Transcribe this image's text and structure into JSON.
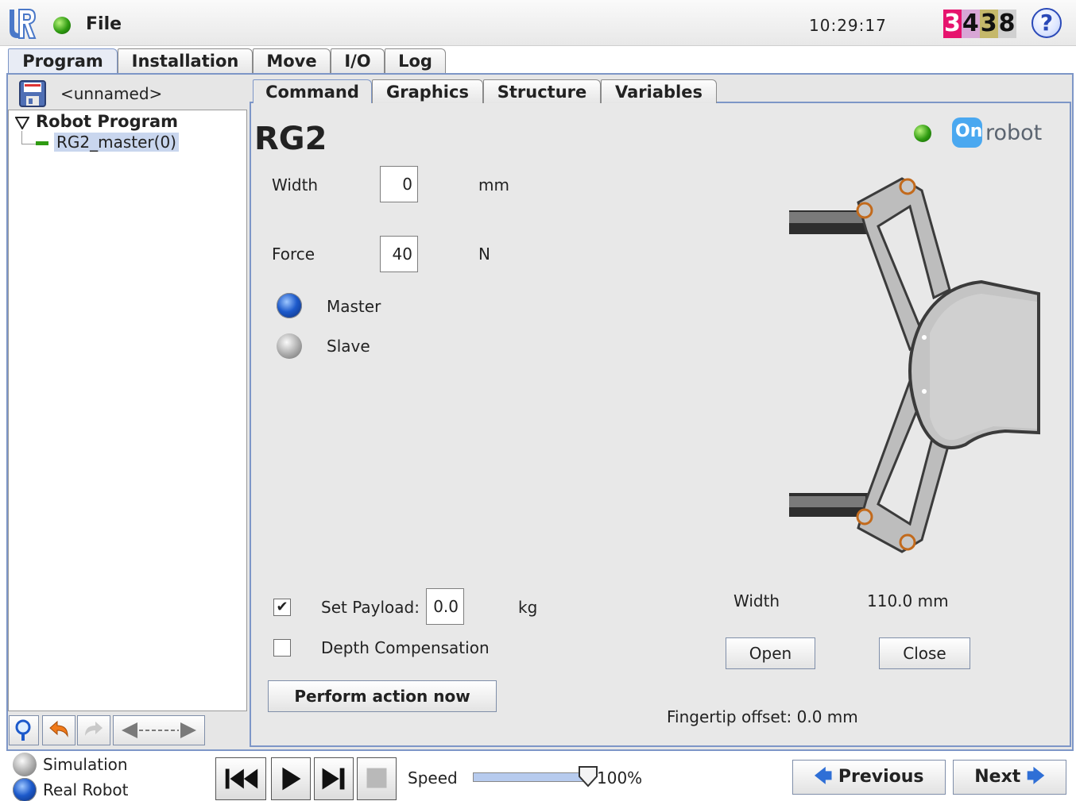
{
  "topbar": {
    "file_label": "File",
    "clock": "10:29:17",
    "counter_digits": [
      "3",
      "4",
      "3",
      "8"
    ],
    "counter_colors": [
      "#e6146e",
      "#d8a6d6",
      "#c5b86a",
      "#d0d0d0"
    ],
    "help_label": "?"
  },
  "main_tabs": [
    "Program",
    "Installation",
    "Move",
    "I/O",
    "Log"
  ],
  "program": {
    "filename": "<unnamed>",
    "tree_root": "Robot Program",
    "tree_child": "RG2_master(0)"
  },
  "sub_tabs": [
    "Command",
    "Graphics",
    "Structure",
    "Variables"
  ],
  "rg2": {
    "title": "RG2",
    "width_label": "Width",
    "width_value": "0",
    "width_unit": "mm",
    "force_label": "Force",
    "force_value": "40",
    "force_unit": "N",
    "master_label": "Master",
    "slave_label": "Slave",
    "brand": "robot",
    "brand_badge": "On",
    "payload_label": "Set Payload:",
    "payload_value": "0.0",
    "payload_unit": "kg",
    "payload_checked": true,
    "depth_label": "Depth Compensation",
    "depth_checked": false,
    "perform_label": "Perform action now",
    "gripper_width_label": "Width",
    "gripper_width_value": "110.0 mm",
    "open_label": "Open",
    "close_label": "Close",
    "fingertip_label": "Fingertip offset: 0.0 mm"
  },
  "bottom": {
    "simulation_label": "Simulation",
    "real_robot_label": "Real Robot",
    "speed_label": "Speed",
    "speed_value": "100%",
    "speed_fraction": 1.0,
    "previous_label": "Previous",
    "next_label": "Next"
  }
}
